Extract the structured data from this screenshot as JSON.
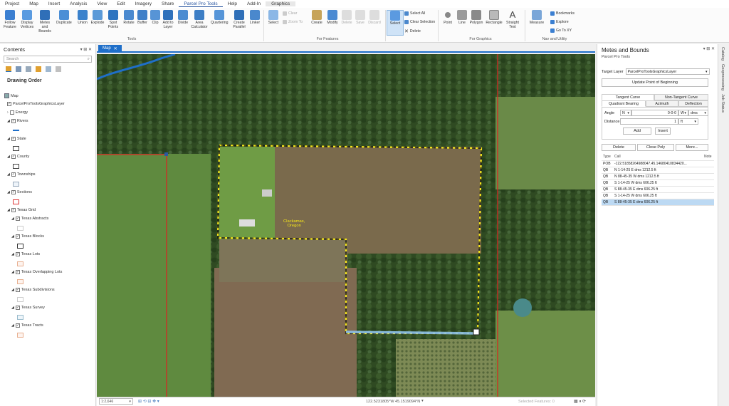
{
  "menu": {
    "items": [
      "Project",
      "Map",
      "Insert",
      "Analysis",
      "View",
      "Edit",
      "Imagery",
      "Share",
      "Parcel Pro Tools",
      "Help",
      "Add-In"
    ],
    "active": "Parcel Pro Tools",
    "context_tab": "Graphics"
  },
  "ribbon": {
    "tools": [
      "Follow Feature",
      "Display Vertices",
      "Metes and Bounds",
      "Duplicate",
      "Union",
      "Explode",
      "Spot Points",
      "Rotate",
      "Buffer",
      "Clip",
      "Add to Layer",
      "Divide",
      "Area Calculator",
      "Quartering",
      "Create Parallel",
      "Linker"
    ],
    "select_label": "Select",
    "clear_label": "Clear",
    "zoom_to_label": "Zoom To",
    "features": [
      "Create",
      "Modify",
      "Delete",
      "Save",
      "Discard"
    ],
    "graphics_select": "Select",
    "select_all": "Select All",
    "clear_selection": "Clear Selection",
    "delete": "Delete",
    "graphics": [
      "Point",
      "Line",
      "Polygon",
      "Rectangle",
      "Straight Text"
    ],
    "measure": "Measure",
    "bookmarks": "Bookmarks",
    "explore": "Explore",
    "go_to_xy": "Go To XY",
    "groups": {
      "tools": "Tools",
      "for_features": "For Features",
      "for_graphics": "For Graphics",
      "nav": "Nav and Utility"
    }
  },
  "contents": {
    "title": "Contents",
    "search_placeholder": "Search",
    "drawing_order": "Drawing Order",
    "layers": [
      {
        "name": "Map"
      },
      {
        "name": "ParcelProToolsGraphicsLayer"
      },
      {
        "name": "Energy"
      },
      {
        "name": "Rivers"
      },
      {
        "name": "State"
      },
      {
        "name": "County"
      },
      {
        "name": "Townships"
      },
      {
        "name": "Sections"
      },
      {
        "name": "Texas Grid"
      },
      {
        "name": "Texas Abstracts"
      },
      {
        "name": "Texas Blocks"
      },
      {
        "name": "Texas Lots"
      },
      {
        "name": "Texas Overlapping Lots"
      },
      {
        "name": "Texas Subdivisions"
      },
      {
        "name": "Texas Survey"
      },
      {
        "name": "Texas Tracts"
      }
    ]
  },
  "map": {
    "tab": "Map",
    "label_line1": "Clackamas,",
    "label_line2": "Oregon",
    "scale": "1:2,646",
    "coords": "122.5231805°W 45.1519094°N",
    "selected_features": "Selected Features: 0"
  },
  "panel": {
    "title": "Metes and Bounds",
    "subtitle": "Parcel Pro Tools",
    "target_layer_label": "Target Layer",
    "target_layer_value": "ParcelProToolsGraphicsLayer",
    "update_pob": "Update Point of Beginning",
    "tabs_top": [
      "Tangent Curve",
      "Non-Tangent Curve"
    ],
    "tabs_bottom": [
      "Quadrant Bearing",
      "Azimuth",
      "Deflection"
    ],
    "angle_label": "Angle",
    "angle_dir1": "N",
    "angle_value": "0-0-0",
    "angle_dir2": "W",
    "angle_unit": "dms",
    "distance_label": "Distance",
    "distance_value": "1",
    "distance_unit": "ft",
    "add": "Add",
    "insert": "Insert",
    "delete": "Delete",
    "close_poly": "Close Poly",
    "more": "More...",
    "table_headers": [
      "Type",
      "Call",
      "Note"
    ],
    "rows": [
      {
        "type": "POB",
        "call": "-122.51858264988047,45.14680410834420..."
      },
      {
        "type": "QB",
        "call": "N 1-14-25 E dms 1212.5 ft"
      },
      {
        "type": "QB",
        "call": "N 88-45-35 W dms 1212.5 ft"
      },
      {
        "type": "QB",
        "call": "S 1-14-25 W dms 606.25 ft"
      },
      {
        "type": "QB",
        "call": "S 88-45-35 E dms 606.25 ft"
      },
      {
        "type": "QB",
        "call": "S 1-14-25 W dms 606.25 ft"
      },
      {
        "type": "QB",
        "call": "S 88-45-35 E dms 606.25 ft"
      }
    ]
  },
  "side_tabs": [
    "Catalog",
    "Geoprocessing",
    "Job Status"
  ]
}
